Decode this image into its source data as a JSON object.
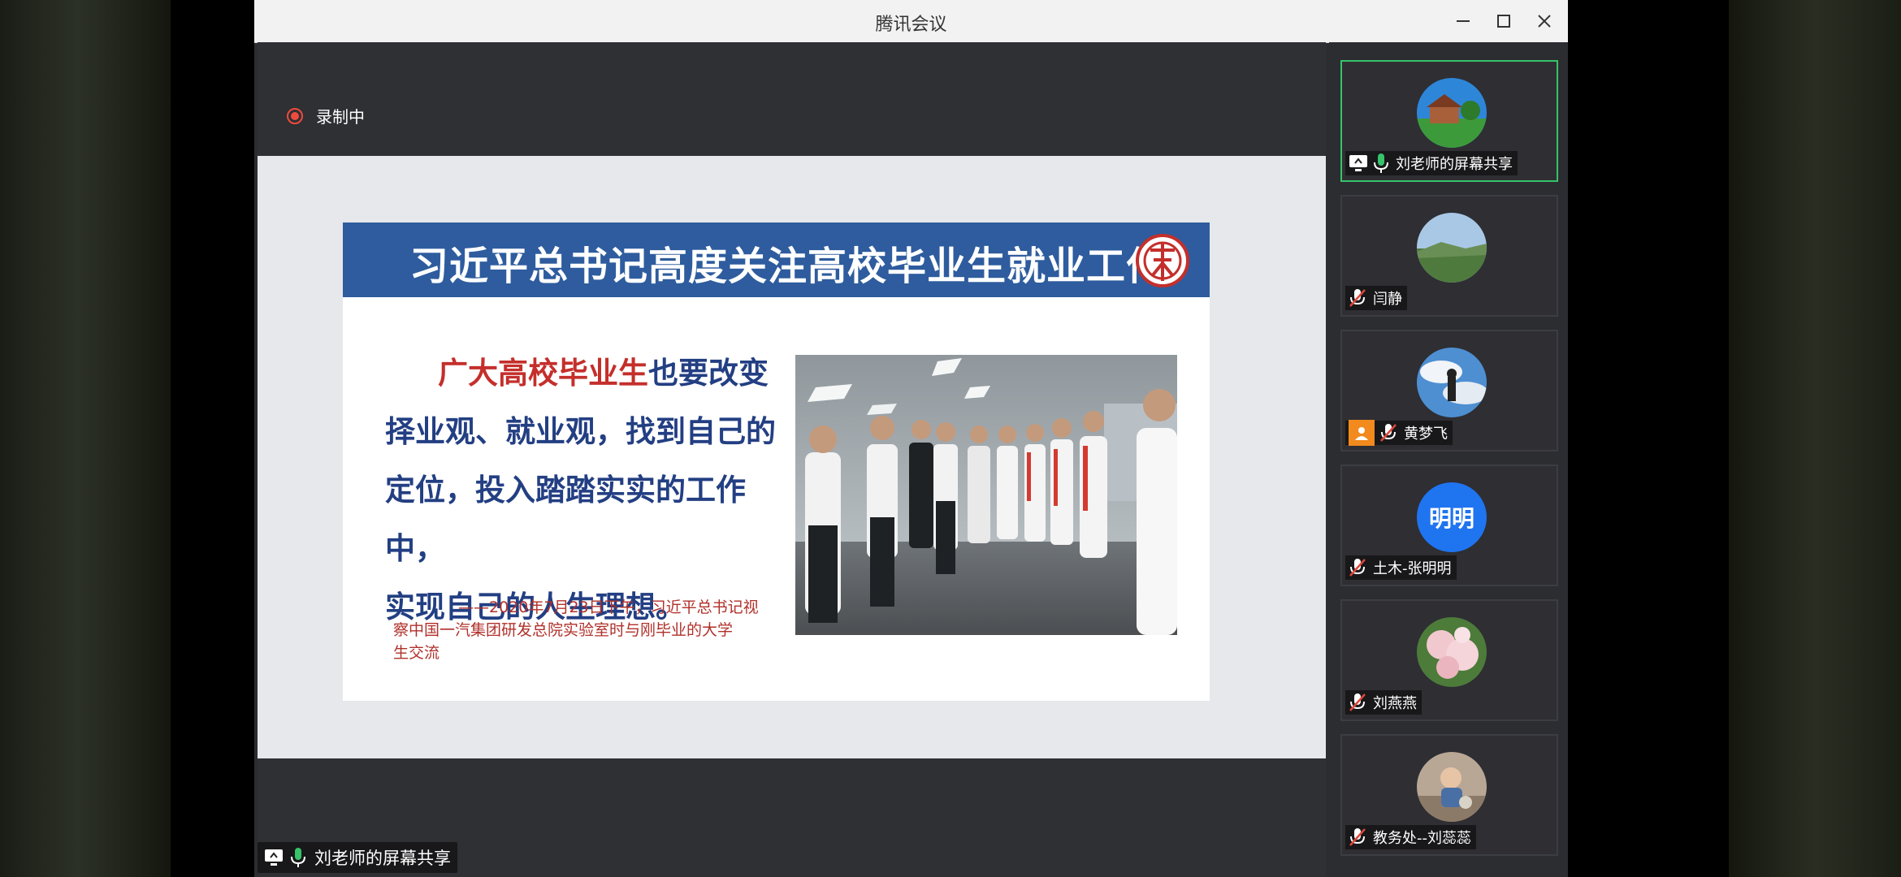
{
  "window": {
    "title": "腾讯会议"
  },
  "recording": {
    "label": "录制中",
    "color": "#f04a3c"
  },
  "slide": {
    "title": "习近平总书记高度关注高校毕业生就业工作",
    "quote_highlight": "广大高校毕业生",
    "quote_line1_rest": "也要改变",
    "quote_line2": "择业观、就业观，找到自己的",
    "quote_line3": "定位，投入踏踏实实的工作中，",
    "quote_line4": "实现自己的人生理想。",
    "caption_line1": "——2020年7月23日下午，习近平总书记视",
    "caption_line2": "察中国一汽集团研发总院实验室时与刚毕业的大学",
    "caption_line3": "生交流",
    "header_color": "#2e5c9e",
    "highlight_color": "#c42f2b"
  },
  "share_bar": {
    "label": "刘老师的屏幕共享"
  },
  "participants": [
    {
      "name": "刘老师的屏幕共享",
      "avatar": "house-landscape-photo",
      "mic": "on",
      "screen_share": true,
      "active": true
    },
    {
      "name": "闫静",
      "avatar": "mountain-landscape-photo",
      "mic": "muted"
    },
    {
      "name": "黄梦飞",
      "avatar": "person-sky-photo",
      "mic": "muted",
      "badge": "person-icon"
    },
    {
      "name": "土木-张明明",
      "avatar_text": "明明",
      "mic": "muted"
    },
    {
      "name": "刘燕燕",
      "avatar": "flowers-photo",
      "mic": "muted"
    },
    {
      "name": "教务处--刘蕊蕊",
      "avatar": "child-photo",
      "mic": "muted"
    }
  ],
  "colors": {
    "active_border": "#36c36a",
    "mic_on": "#36c36a",
    "muted": "#e0463a",
    "avatar_text_bg": "#1f74f0"
  }
}
